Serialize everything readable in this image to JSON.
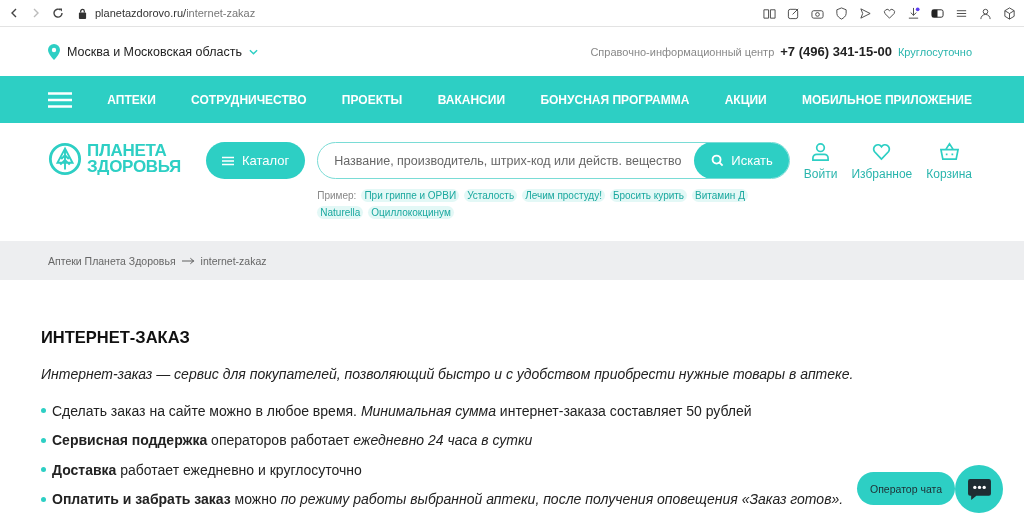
{
  "browser": {
    "url_host": "planetazdorovo.ru/",
    "url_path": "internet-zakaz"
  },
  "topbar": {
    "region": "Москва и Московская область",
    "info_label": "Справочно-информационный центр",
    "phone": "+7 (496) 341-15-00",
    "hours": "Круглосуточно"
  },
  "nav": {
    "items": [
      "АПТЕКИ",
      "СОТРУДНИЧЕСТВО",
      "ПРОЕКТЫ",
      "ВАКАНСИИ",
      "БОНУСНАЯ ПРОГРАММА",
      "АКЦИИ",
      "МОБИЛЬНОЕ ПРИЛОЖЕНИЕ"
    ]
  },
  "header": {
    "logo_line1": "ПЛАНЕТА",
    "logo_line2": "ЗДОРОВЬЯ",
    "catalog": "Каталог",
    "search": {
      "placeholder": "Название, производитель, штрих-код или действ. вещество",
      "button": "Искать"
    },
    "examples_label": "Пример:",
    "examples": [
      "При гриппе и ОРВИ",
      "Усталость",
      "Лечим простуду!",
      "Бросить курить",
      "Витамин Д",
      "Naturella",
      "Оциллококцинум"
    ],
    "actions": [
      {
        "kind": "user",
        "label": "Войти"
      },
      {
        "kind": "heart",
        "label": "Избранное"
      },
      {
        "kind": "basket",
        "label": "Корзина"
      }
    ]
  },
  "breadcrumbs": [
    "Аптеки Планета Здоровья",
    "internet-zakaz"
  ],
  "content": {
    "title": "ИНТЕРНЕТ-ЗАКАЗ",
    "intro": "Интернет-заказ — сервис для покупателей, позволяющий быстро и с удобством приобрести нужные товары в аптеке.",
    "bullets": [
      "Сделать заказ на сайте можно в любое время. *Минимальная сумма* интернет-заказа составляет 50 рублей",
      "**Сервисная поддержка** операторов работает *ежедневно 24 часа в сутки*",
      "**Доставка** работает ежедневно и круглосуточно",
      "**Оплатить и забрать заказ** можно *по режиму работы выбранной аптеки, после получения оповещения «Заказ готов».*"
    ]
  },
  "chat": {
    "label": "Оператор чата"
  }
}
